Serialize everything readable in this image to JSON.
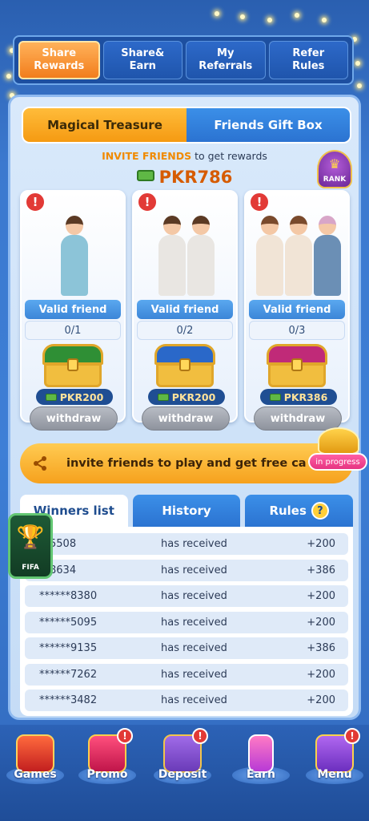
{
  "top_tabs": [
    {
      "label": "Share\nRewards",
      "active": true
    },
    {
      "label": "Share&\nEarn",
      "active": false
    },
    {
      "label": "My\nReferrals",
      "active": false
    },
    {
      "label": "Refer\nRules",
      "active": false
    }
  ],
  "segment": {
    "active": "Magical Treasure",
    "inactive": "Friends Gift Box"
  },
  "invite": {
    "highlight": "INVITE FRIENDS",
    "rest": " to get  rewards"
  },
  "total_prize": "PKR786",
  "rank_label": "RANK",
  "cards": [
    {
      "valid_label": "Valid friend",
      "progress": "0/1",
      "reward": "PKR200",
      "action": "withdraw",
      "chest_color": "#2f8f35"
    },
    {
      "valid_label": "Valid friend",
      "progress": "0/2",
      "reward": "PKR200",
      "action": "withdraw",
      "chest_color": "#2a68c9"
    },
    {
      "valid_label": "Valid friend",
      "progress": "0/3",
      "reward": "PKR386",
      "action": "withdraw",
      "chest_color": "#c02a78"
    }
  ],
  "invite_banner": {
    "text": "invite friends to play and get free ca",
    "badge": "in progress"
  },
  "list_tabs": {
    "winners": "Winners list",
    "history": "History",
    "rules": "Rules",
    "rules_icon": "?"
  },
  "winners": [
    {
      "user": "**5508",
      "status": "has received",
      "amount": "+200"
    },
    {
      "user": "**8634",
      "status": "has received",
      "amount": "+386"
    },
    {
      "user": "******8380",
      "status": "has received",
      "amount": "+200"
    },
    {
      "user": "******5095",
      "status": "has received",
      "amount": "+200"
    },
    {
      "user": "******9135",
      "status": "has received",
      "amount": "+386"
    },
    {
      "user": "******7262",
      "status": "has received",
      "amount": "+200"
    },
    {
      "user": "******3482",
      "status": "has received",
      "amount": "+200"
    }
  ],
  "fifa_label": "FIFA",
  "alert_mark": "!",
  "bottom_nav": [
    {
      "label": "Games",
      "badge": ""
    },
    {
      "label": "Promo",
      "badge": "!"
    },
    {
      "label": "Deposit",
      "badge": "!"
    },
    {
      "label": "Earn",
      "badge": ""
    },
    {
      "label": "Menu",
      "badge": "!"
    }
  ]
}
